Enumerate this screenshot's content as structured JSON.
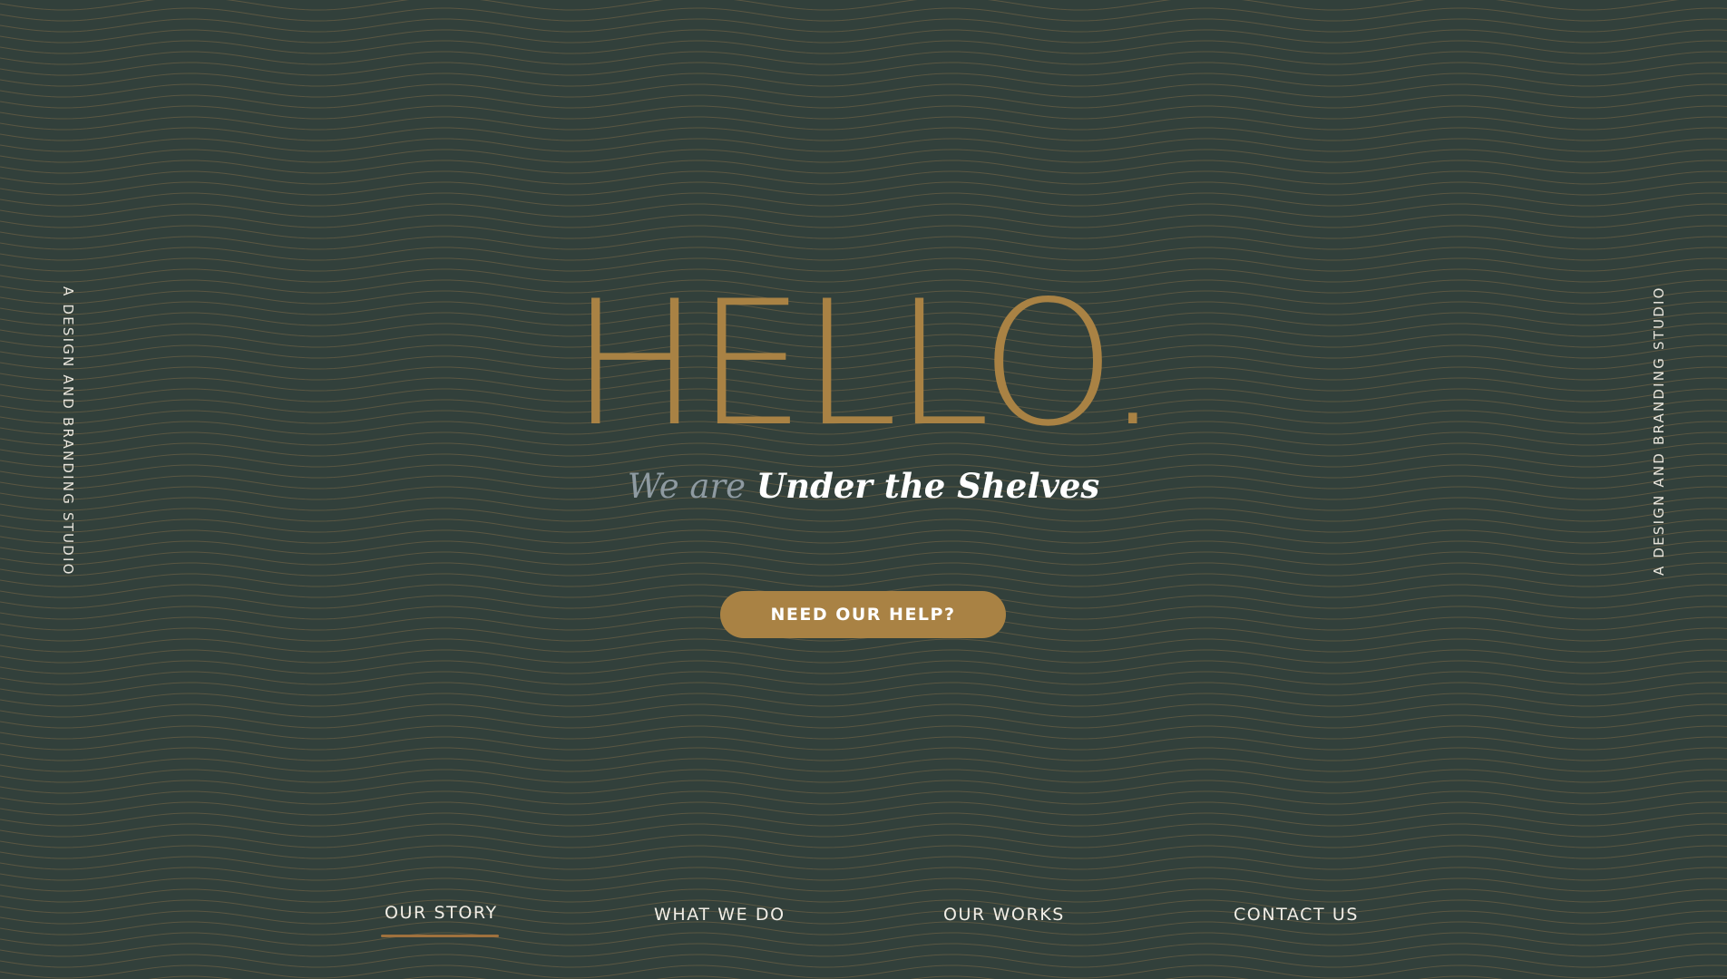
{
  "side": {
    "left_text": "A DESIGN AND BRANDING STUDIO",
    "right_text": "A DESIGN AND BRANDING STUDIO"
  },
  "hero": {
    "title": "HELLO.",
    "tagline_lead": "We are",
    "tagline_brand": "Under the Shelves"
  },
  "cta": {
    "label": "NEED OUR HELP?"
  },
  "nav": {
    "items": [
      {
        "label": "OUR STORY",
        "active": true
      },
      {
        "label": "WHAT WE DO",
        "active": false
      },
      {
        "label": "OUR WORKS",
        "active": false
      },
      {
        "label": "CONTACT US",
        "active": false
      }
    ]
  },
  "colors": {
    "background": "#32403b",
    "accent_gold": "#a98244",
    "wave_line": "#7d6a48",
    "text_light": "#f2eee6",
    "tagline_muted": "#8e9aa1"
  }
}
